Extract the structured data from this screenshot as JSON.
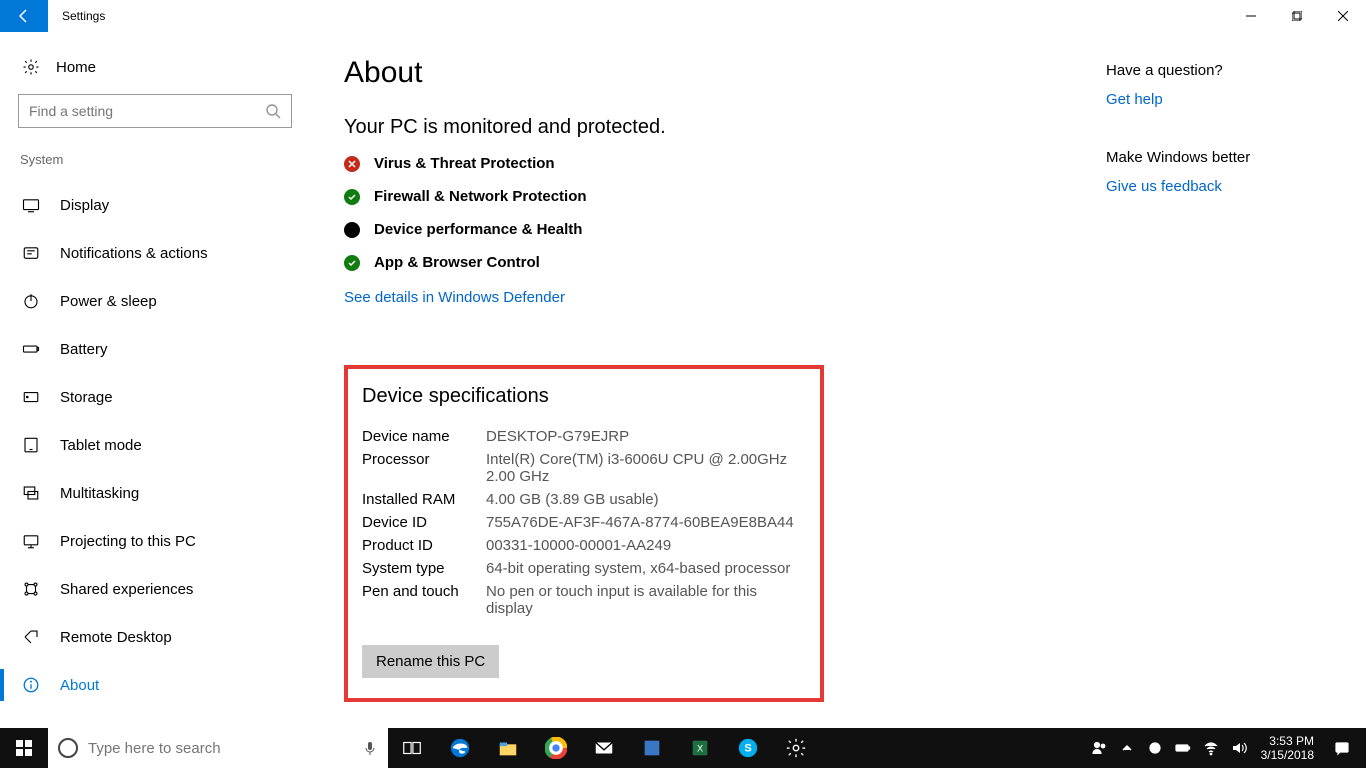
{
  "window": {
    "title": "Settings"
  },
  "sidebar": {
    "home_label": "Home",
    "search_placeholder": "Find a setting",
    "group_label": "System",
    "items": [
      {
        "label": "Display"
      },
      {
        "label": "Notifications & actions"
      },
      {
        "label": "Power & sleep"
      },
      {
        "label": "Battery"
      },
      {
        "label": "Storage"
      },
      {
        "label": "Tablet mode"
      },
      {
        "label": "Multitasking"
      },
      {
        "label": "Projecting to this PC"
      },
      {
        "label": "Shared experiences"
      },
      {
        "label": "Remote Desktop"
      },
      {
        "label": "About",
        "active": true
      }
    ]
  },
  "main": {
    "title": "About",
    "subheading": "Your PC is monitored and protected.",
    "protection": [
      {
        "label": "Virus & Threat Protection",
        "status": "bad"
      },
      {
        "label": "Firewall & Network Protection",
        "status": "good"
      },
      {
        "label": "Device performance & Health",
        "status": "neutral"
      },
      {
        "label": "App & Browser Control",
        "status": "good"
      }
    ],
    "defender_link": "See details in Windows Defender",
    "specs_title": "Device specifications",
    "specs": {
      "device_name_label": "Device name",
      "device_name_value": "DESKTOP-G79EJRP",
      "processor_label": "Processor",
      "processor_value": "Intel(R) Core(TM) i3-6006U CPU @ 2.00GHz   2.00 GHz",
      "ram_label": "Installed RAM",
      "ram_value": "4.00 GB (3.89 GB usable)",
      "device_id_label": "Device ID",
      "device_id_value": "755A76DE-AF3F-467A-8774-60BEA9E8BA44",
      "product_id_label": "Product ID",
      "product_id_value": "00331-10000-00001-AA249",
      "system_type_label": "System type",
      "system_type_value": "64-bit operating system, x64-based processor",
      "pen_touch_label": "Pen and touch",
      "pen_touch_value": "No pen or touch input is available for this display"
    },
    "rename_button": "Rename this PC"
  },
  "right_rail": {
    "question_head": "Have a question?",
    "question_link": "Get help",
    "better_head": "Make Windows better",
    "better_link": "Give us feedback"
  },
  "taskbar": {
    "search_placeholder": "Type here to search",
    "time": "3:53 PM",
    "date": "3/15/2018"
  }
}
